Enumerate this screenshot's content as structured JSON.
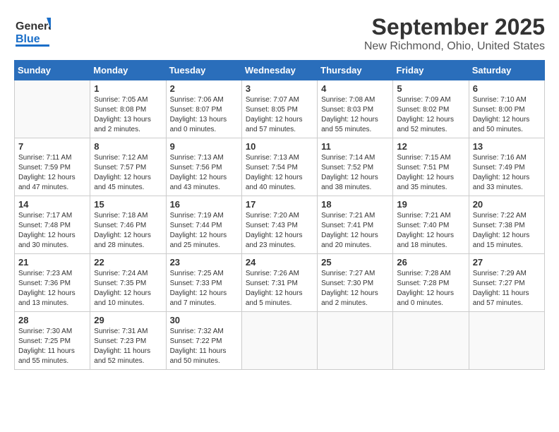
{
  "header": {
    "logo_general": "General",
    "logo_blue": "Blue",
    "title": "September 2025",
    "subtitle": "New Richmond, Ohio, United States"
  },
  "calendar": {
    "days_of_week": [
      "Sunday",
      "Monday",
      "Tuesday",
      "Wednesday",
      "Thursday",
      "Friday",
      "Saturday"
    ],
    "weeks": [
      [
        {
          "day": "",
          "info": ""
        },
        {
          "day": "1",
          "info": "Sunrise: 7:05 AM\nSunset: 8:08 PM\nDaylight: 13 hours\nand 2 minutes."
        },
        {
          "day": "2",
          "info": "Sunrise: 7:06 AM\nSunset: 8:07 PM\nDaylight: 13 hours\nand 0 minutes."
        },
        {
          "day": "3",
          "info": "Sunrise: 7:07 AM\nSunset: 8:05 PM\nDaylight: 12 hours\nand 57 minutes."
        },
        {
          "day": "4",
          "info": "Sunrise: 7:08 AM\nSunset: 8:03 PM\nDaylight: 12 hours\nand 55 minutes."
        },
        {
          "day": "5",
          "info": "Sunrise: 7:09 AM\nSunset: 8:02 PM\nDaylight: 12 hours\nand 52 minutes."
        },
        {
          "day": "6",
          "info": "Sunrise: 7:10 AM\nSunset: 8:00 PM\nDaylight: 12 hours\nand 50 minutes."
        }
      ],
      [
        {
          "day": "7",
          "info": "Sunrise: 7:11 AM\nSunset: 7:59 PM\nDaylight: 12 hours\nand 47 minutes."
        },
        {
          "day": "8",
          "info": "Sunrise: 7:12 AM\nSunset: 7:57 PM\nDaylight: 12 hours\nand 45 minutes."
        },
        {
          "day": "9",
          "info": "Sunrise: 7:13 AM\nSunset: 7:56 PM\nDaylight: 12 hours\nand 43 minutes."
        },
        {
          "day": "10",
          "info": "Sunrise: 7:13 AM\nSunset: 7:54 PM\nDaylight: 12 hours\nand 40 minutes."
        },
        {
          "day": "11",
          "info": "Sunrise: 7:14 AM\nSunset: 7:52 PM\nDaylight: 12 hours\nand 38 minutes."
        },
        {
          "day": "12",
          "info": "Sunrise: 7:15 AM\nSunset: 7:51 PM\nDaylight: 12 hours\nand 35 minutes."
        },
        {
          "day": "13",
          "info": "Sunrise: 7:16 AM\nSunset: 7:49 PM\nDaylight: 12 hours\nand 33 minutes."
        }
      ],
      [
        {
          "day": "14",
          "info": "Sunrise: 7:17 AM\nSunset: 7:48 PM\nDaylight: 12 hours\nand 30 minutes."
        },
        {
          "day": "15",
          "info": "Sunrise: 7:18 AM\nSunset: 7:46 PM\nDaylight: 12 hours\nand 28 minutes."
        },
        {
          "day": "16",
          "info": "Sunrise: 7:19 AM\nSunset: 7:44 PM\nDaylight: 12 hours\nand 25 minutes."
        },
        {
          "day": "17",
          "info": "Sunrise: 7:20 AM\nSunset: 7:43 PM\nDaylight: 12 hours\nand 23 minutes."
        },
        {
          "day": "18",
          "info": "Sunrise: 7:21 AM\nSunset: 7:41 PM\nDaylight: 12 hours\nand 20 minutes."
        },
        {
          "day": "19",
          "info": "Sunrise: 7:21 AM\nSunset: 7:40 PM\nDaylight: 12 hours\nand 18 minutes."
        },
        {
          "day": "20",
          "info": "Sunrise: 7:22 AM\nSunset: 7:38 PM\nDaylight: 12 hours\nand 15 minutes."
        }
      ],
      [
        {
          "day": "21",
          "info": "Sunrise: 7:23 AM\nSunset: 7:36 PM\nDaylight: 12 hours\nand 13 minutes."
        },
        {
          "day": "22",
          "info": "Sunrise: 7:24 AM\nSunset: 7:35 PM\nDaylight: 12 hours\nand 10 minutes."
        },
        {
          "day": "23",
          "info": "Sunrise: 7:25 AM\nSunset: 7:33 PM\nDaylight: 12 hours\nand 7 minutes."
        },
        {
          "day": "24",
          "info": "Sunrise: 7:26 AM\nSunset: 7:31 PM\nDaylight: 12 hours\nand 5 minutes."
        },
        {
          "day": "25",
          "info": "Sunrise: 7:27 AM\nSunset: 7:30 PM\nDaylight: 12 hours\nand 2 minutes."
        },
        {
          "day": "26",
          "info": "Sunrise: 7:28 AM\nSunset: 7:28 PM\nDaylight: 12 hours\nand 0 minutes."
        },
        {
          "day": "27",
          "info": "Sunrise: 7:29 AM\nSunset: 7:27 PM\nDaylight: 11 hours\nand 57 minutes."
        }
      ],
      [
        {
          "day": "28",
          "info": "Sunrise: 7:30 AM\nSunset: 7:25 PM\nDaylight: 11 hours\nand 55 minutes."
        },
        {
          "day": "29",
          "info": "Sunrise: 7:31 AM\nSunset: 7:23 PM\nDaylight: 11 hours\nand 52 minutes."
        },
        {
          "day": "30",
          "info": "Sunrise: 7:32 AM\nSunset: 7:22 PM\nDaylight: 11 hours\nand 50 minutes."
        },
        {
          "day": "",
          "info": ""
        },
        {
          "day": "",
          "info": ""
        },
        {
          "day": "",
          "info": ""
        },
        {
          "day": "",
          "info": ""
        }
      ]
    ]
  }
}
